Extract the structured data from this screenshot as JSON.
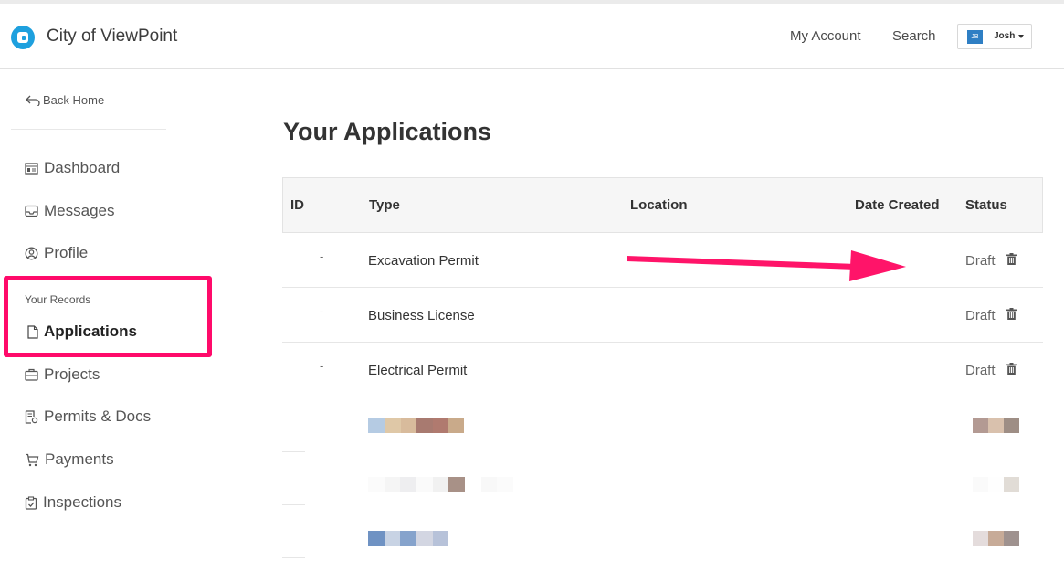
{
  "header": {
    "app_title": "City of ViewPoint",
    "nav": [
      "My Account",
      "Search"
    ],
    "user": {
      "initials": "JB",
      "name": "Josh"
    }
  },
  "sidebar": {
    "back_label": "Back Home",
    "items_top": [
      {
        "label": "Dashboard",
        "icon": "dashboard-icon"
      },
      {
        "label": "Messages",
        "icon": "inbox-icon"
      },
      {
        "label": "Profile",
        "icon": "profile-icon"
      }
    ],
    "section_label": "Your Records",
    "active_item": {
      "label": "Applications",
      "icon": "document-icon"
    },
    "items_bottom": [
      {
        "label": "Projects",
        "icon": "briefcase-icon"
      },
      {
        "label": "Permits & Docs",
        "icon": "permit-icon"
      },
      {
        "label": "Payments",
        "icon": "cart-icon"
      },
      {
        "label": "Inspections",
        "icon": "clipboard-check-icon"
      }
    ]
  },
  "main": {
    "title": "Your Applications",
    "columns": [
      "ID",
      "Type",
      "Location",
      "Date Created",
      "Status"
    ],
    "rows": [
      {
        "id": "-",
        "type": "Excavation Permit",
        "location": "",
        "date": "",
        "status": "Draft"
      },
      {
        "id": "-",
        "type": "Business License",
        "location": "",
        "date": "",
        "status": "Draft"
      },
      {
        "id": "-",
        "type": "Electrical Permit",
        "location": "",
        "date": "",
        "status": "Draft"
      }
    ]
  },
  "annotation": {
    "highlight_color": "#ff0a6a",
    "arrow_color": "#ff0a6a"
  },
  "colors": {
    "brand": "#1ea0de",
    "avatar": "#2f7fc4"
  }
}
